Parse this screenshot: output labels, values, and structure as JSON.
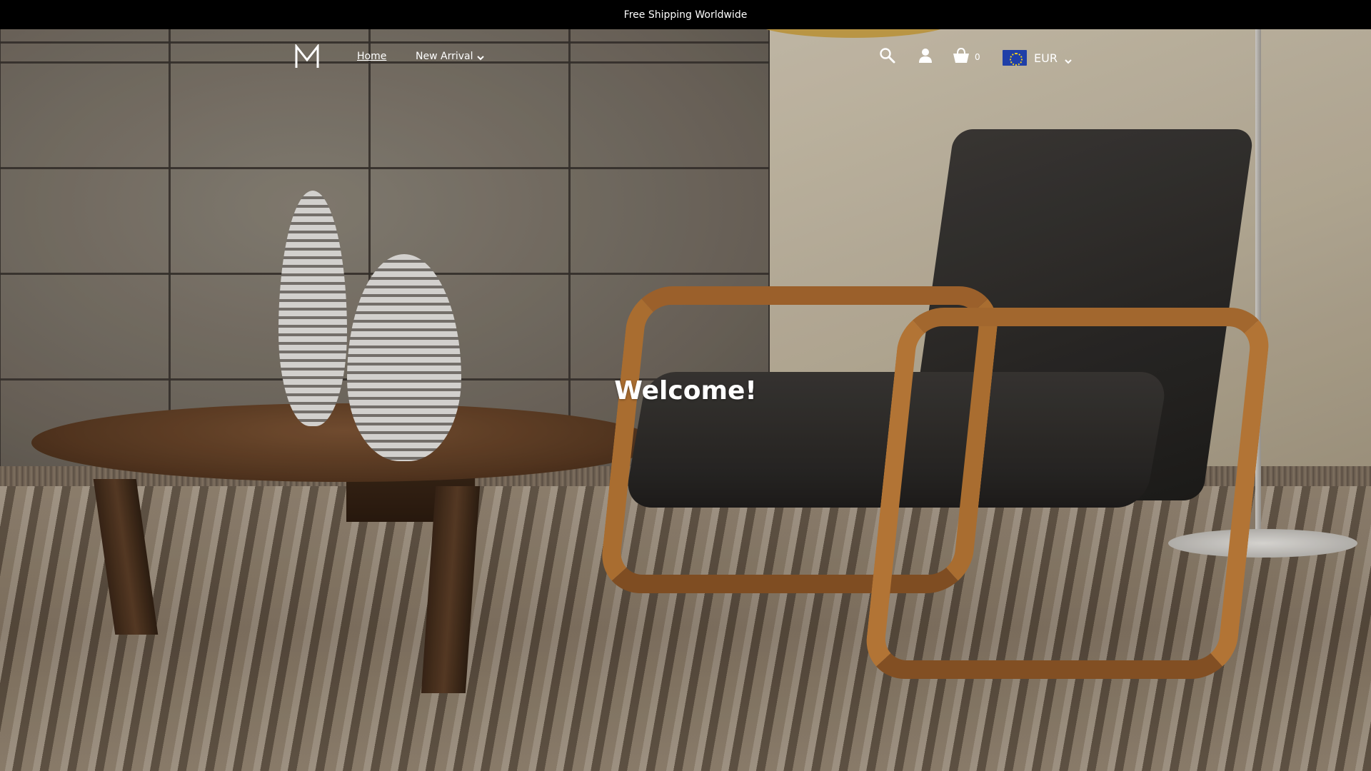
{
  "announcement": {
    "text": "Free Shipping Worldwide"
  },
  "header": {
    "logo_icon": "monogram-m-logo",
    "nav": [
      {
        "label": "Home",
        "active": true
      },
      {
        "label": "New Arrival",
        "has_dropdown": true
      }
    ],
    "icons": [
      "search-icon",
      "account-icon",
      "cart-icon"
    ],
    "cart_count": "0",
    "currency": {
      "code": "EUR",
      "flag": "eu-flag-icon"
    }
  },
  "hero": {
    "title": "Welcome!"
  },
  "colors": {
    "announcement_bg": "#000000",
    "text": "#ffffff",
    "eu_flag_blue": "#1f3fa8",
    "eu_flag_stars": "#f3d21c"
  }
}
